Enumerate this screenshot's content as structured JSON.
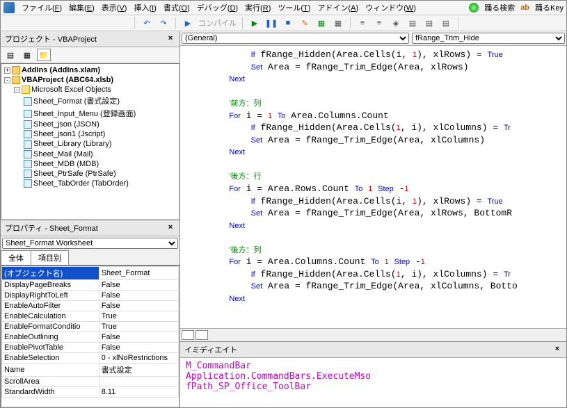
{
  "menu": {
    "items": [
      {
        "label": "ファイル",
        "key": "F"
      },
      {
        "label": "編集",
        "key": "E"
      },
      {
        "label": "表示",
        "key": "V"
      },
      {
        "label": "挿入",
        "key": "I"
      },
      {
        "label": "書式",
        "key": "O"
      },
      {
        "label": "デバッグ",
        "key": "D"
      },
      {
        "label": "実行",
        "key": "R"
      },
      {
        "label": "ツール",
        "key": "T"
      },
      {
        "label": "アドイン",
        "key": "A"
      },
      {
        "label": "ウィンドウ",
        "key": "W"
      }
    ],
    "right": [
      {
        "label": "踊る検索"
      },
      {
        "label": "踊るKey"
      }
    ]
  },
  "toolbar": {
    "compile": "コンパイル"
  },
  "project": {
    "title": "プロジェクト - VBAProject",
    "roots": [
      {
        "pm": "+",
        "kind": "pkg",
        "label": "AddIns (AddIns.xlam)"
      },
      {
        "pm": "-",
        "kind": "pkg",
        "label": "VBAProject (ABC64.xlsb)",
        "children": [
          {
            "pm": "-",
            "kind": "fold",
            "label": "Microsoft Excel Objects",
            "children": [
              {
                "kind": "sheet",
                "label": "Sheet_Format (書式設定)"
              },
              {
                "kind": "sheet",
                "label": "Sheet_Input_Menu (登録画面)"
              },
              {
                "kind": "sheet",
                "label": "Sheet_json (JSON)"
              },
              {
                "kind": "sheet",
                "label": "Sheet_json1 (Jscript)"
              },
              {
                "kind": "sheet",
                "label": "Sheet_Library (Library)"
              },
              {
                "kind": "sheet",
                "label": "Sheet_Mail (Mail)"
              },
              {
                "kind": "sheet",
                "label": "Sheet_MDB (MDB)"
              },
              {
                "kind": "sheet",
                "label": "Sheet_PtrSafe (PtrSafe)"
              },
              {
                "kind": "sheet",
                "label": "Sheet_TabOrder (TabOrder)"
              }
            ]
          }
        ]
      }
    ]
  },
  "properties": {
    "title": "プロパティ - Sheet_Format",
    "objectSelect": "Sheet_Format Worksheet",
    "tabs": [
      "全体",
      "項目別"
    ],
    "rows": [
      {
        "k": "(オブジェクト名)",
        "v": "Sheet_Format",
        "sel": true
      },
      {
        "k": "DisplayPageBreaks",
        "v": "False"
      },
      {
        "k": "DisplayRightToLeft",
        "v": "False"
      },
      {
        "k": "EnableAutoFilter",
        "v": "False"
      },
      {
        "k": "EnableCalculation",
        "v": "True"
      },
      {
        "k": "EnableFormatConditio",
        "v": "True"
      },
      {
        "k": "EnableOutlining",
        "v": "False"
      },
      {
        "k": "EnablePivotTable",
        "v": "False"
      },
      {
        "k": "EnableSelection",
        "v": "0 - xlNoRestrictions"
      },
      {
        "k": "Name",
        "v": "書式設定"
      },
      {
        "k": "ScrollArea",
        "v": ""
      },
      {
        "k": "StandardWidth",
        "v": "8.11"
      }
    ]
  },
  "code": {
    "general": "(General)",
    "proc": "fRange_Trim_Hide",
    "lines": [
      [
        [
          "            ",
          "p"
        ],
        [
          "If",
          "kw"
        ],
        [
          " fRange_Hidden(Area.Cells(i, ",
          "p"
        ],
        [
          "1",
          "num"
        ],
        [
          "), xlRows) = ",
          "p"
        ],
        [
          "True",
          "kw"
        ]
      ],
      [
        [
          "            ",
          "p"
        ],
        [
          "Set",
          "kw"
        ],
        [
          " Area = fRange_Trim_Edge(Area, xlRows)",
          "p"
        ]
      ],
      [
        [
          "        ",
          "p"
        ],
        [
          "Next",
          "kw"
        ]
      ],
      [
        [
          "",
          "p"
        ]
      ],
      [
        [
          "        ",
          "p"
        ],
        [
          "'前方：列",
          "cm"
        ]
      ],
      [
        [
          "        ",
          "p"
        ],
        [
          "For",
          "kw"
        ],
        [
          " i = ",
          "p"
        ],
        [
          "1",
          "num"
        ],
        [
          " ",
          "p"
        ],
        [
          "To",
          "kw"
        ],
        [
          " Area.Columns.Count",
          "p"
        ]
      ],
      [
        [
          "            ",
          "p"
        ],
        [
          "If",
          "kw"
        ],
        [
          " fRange_Hidden(Area.Cells(",
          "p"
        ],
        [
          "1",
          "num"
        ],
        [
          ", i), xlColumns) = ",
          "p"
        ],
        [
          "Tr",
          "kw"
        ]
      ],
      [
        [
          "            ",
          "p"
        ],
        [
          "Set",
          "kw"
        ],
        [
          " Area = fRange_Trim_Edge(Area, xlColumns)",
          "p"
        ]
      ],
      [
        [
          "        ",
          "p"
        ],
        [
          "Next",
          "kw"
        ]
      ],
      [
        [
          "",
          "p"
        ]
      ],
      [
        [
          "        ",
          "p"
        ],
        [
          "'後方：行",
          "cm"
        ]
      ],
      [
        [
          "        ",
          "p"
        ],
        [
          "For",
          "kw"
        ],
        [
          " i = Area.Rows.Count ",
          "p"
        ],
        [
          "To",
          "kw"
        ],
        [
          " ",
          "p"
        ],
        [
          "1",
          "num"
        ],
        [
          " ",
          "p"
        ],
        [
          "Step",
          "kw"
        ],
        [
          " -",
          "p"
        ],
        [
          "1",
          "num"
        ]
      ],
      [
        [
          "            ",
          "p"
        ],
        [
          "If",
          "kw"
        ],
        [
          " fRange_Hidden(Area.Cells(i, ",
          "p"
        ],
        [
          "1",
          "num"
        ],
        [
          "), xlRows) = ",
          "p"
        ],
        [
          "True",
          "kw"
        ]
      ],
      [
        [
          "            ",
          "p"
        ],
        [
          "Set",
          "kw"
        ],
        [
          " Area = fRange_Trim_Edge(Area, xlRows, BottomR",
          "p"
        ]
      ],
      [
        [
          "        ",
          "p"
        ],
        [
          "Next",
          "kw"
        ]
      ],
      [
        [
          "",
          "p"
        ]
      ],
      [
        [
          "        ",
          "p"
        ],
        [
          "'後方：列",
          "cm"
        ]
      ],
      [
        [
          "        ",
          "p"
        ],
        [
          "For",
          "kw"
        ],
        [
          " i = Area.Columns.Count ",
          "p"
        ],
        [
          "To",
          "kw"
        ],
        [
          " ",
          "p"
        ],
        [
          "1",
          "num"
        ],
        [
          " ",
          "p"
        ],
        [
          "Step",
          "kw"
        ],
        [
          " -",
          "p"
        ],
        [
          "1",
          "num"
        ]
      ],
      [
        [
          "            ",
          "p"
        ],
        [
          "If",
          "kw"
        ],
        [
          " fRange_Hidden(Area.Cells(",
          "p"
        ],
        [
          "1",
          "num"
        ],
        [
          ", i), xlColumns) = ",
          "p"
        ],
        [
          "Tr",
          "kw"
        ]
      ],
      [
        [
          "            ",
          "p"
        ],
        [
          "Set",
          "kw"
        ],
        [
          " Area = fRange_Trim_Edge(Area, xlColumns, Botto",
          "p"
        ]
      ],
      [
        [
          "        ",
          "p"
        ],
        [
          "Next",
          "kw"
        ]
      ]
    ]
  },
  "immediate": {
    "title": "イミディエイト",
    "lines": [
      "M_CommandBar",
      "Application.CommandBars.ExecuteMso",
      "fPath_SP_Office_ToolBar"
    ]
  }
}
